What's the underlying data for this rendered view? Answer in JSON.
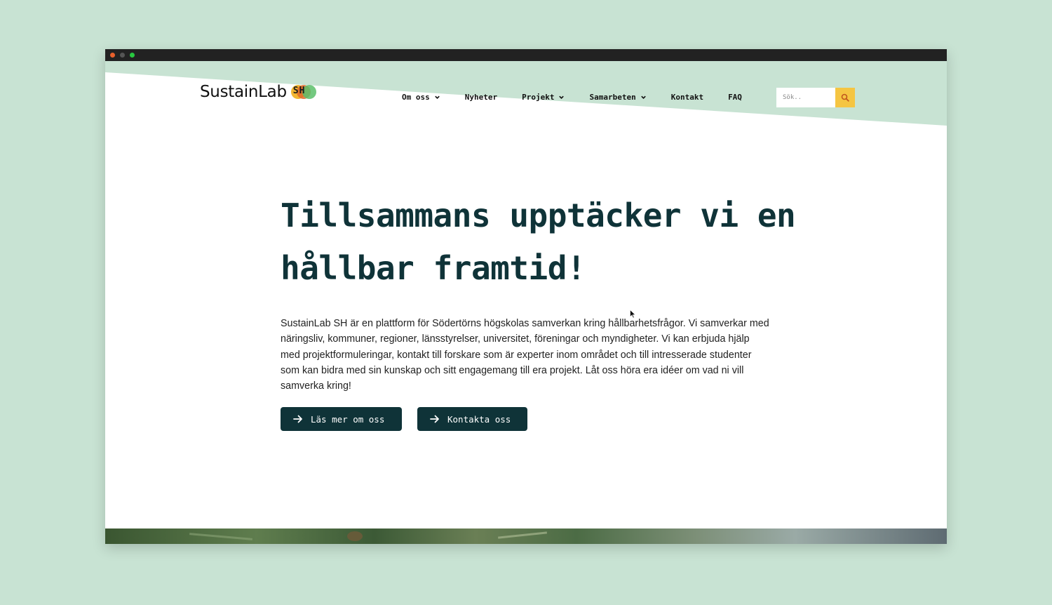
{
  "colors": {
    "page_background": "#c8e3d3",
    "header_band": "#c8e3d3",
    "primary": "#0f3338",
    "search_button": "#f5c542"
  },
  "site": {
    "logo_text": "SustainLab",
    "logo_mark_text": "SH"
  },
  "nav": {
    "items": [
      {
        "label": "Om oss",
        "has_dropdown": true
      },
      {
        "label": "Nyheter",
        "has_dropdown": false
      },
      {
        "label": "Projekt",
        "has_dropdown": true
      },
      {
        "label": "Samarbeten",
        "has_dropdown": true
      },
      {
        "label": "Kontakt",
        "has_dropdown": false
      },
      {
        "label": "FAQ",
        "has_dropdown": false
      }
    ]
  },
  "search": {
    "placeholder": "Sök..",
    "icon": "search-icon"
  },
  "hero": {
    "title": "Tillsammans upptäcker vi en hållbar framtid!",
    "text": "SustainLab SH är en plattform för Södertörns högskolas samverkan kring hållbarhetsfrågor. Vi samverkar med näringsliv, kommuner, regioner, länsstyrelser, universitet, föreningar och myndigheter. Vi kan erbjuda hjälp med projektformuleringar, kontakt till forskare som är experter inom området och till intresserade studenter som kan bidra med sin kunskap och sitt engagemang till era projekt. Låt oss höra era idéer om vad ni vill samverka kring!",
    "buttons": [
      {
        "label": "Läs mer om oss",
        "icon": "arrow-right-icon"
      },
      {
        "label": "Kontakta oss",
        "icon": "arrow-right-icon"
      }
    ]
  }
}
